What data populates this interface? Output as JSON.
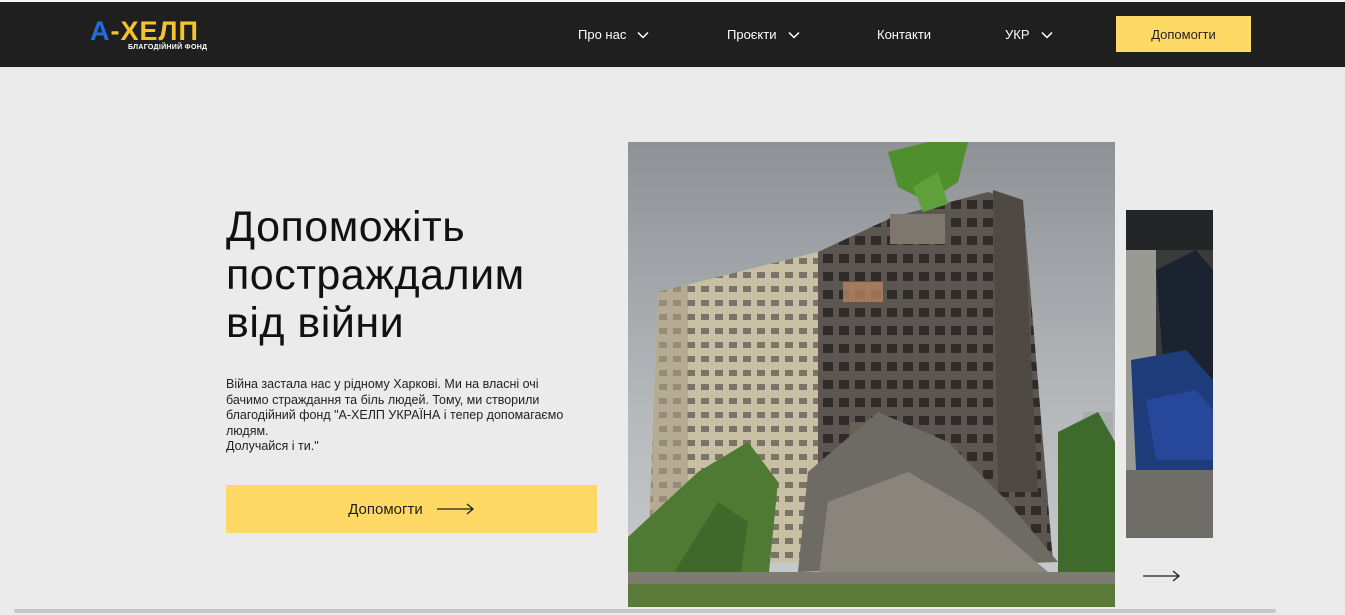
{
  "header": {
    "logo": {
      "mark": "А",
      "name": "-ХЕЛП",
      "subtitle": "БЛАГОДІЙНИЙ ФОНД"
    },
    "nav": [
      {
        "label": "Про нас",
        "has_dropdown": true
      },
      {
        "label": "Проєкти",
        "has_dropdown": true
      },
      {
        "label": "Контакти",
        "has_dropdown": false
      },
      {
        "label": "УКР",
        "has_dropdown": true
      }
    ],
    "cta_label": "Допомогти"
  },
  "hero": {
    "title_lines": [
      "Допоможіть",
      "постраждалим",
      "від війни"
    ],
    "description_lines": [
      "Війна застала нас у рідному Харкові. Ми на власні очі",
      "бачимо страждання та біль людей. Тому, ми створили",
      "благодійний фонд \"А-ХЕЛП УКРАЇНА і тепер допомагаємо",
      "людям.",
      "Долучайся і ти.\""
    ],
    "button_label": "Допомогти"
  },
  "slider": {
    "slides": [
      "damaged-building-photo",
      "volunteer-photo"
    ],
    "next_icon": "arrow-right-icon"
  },
  "colors": {
    "header_bg": "#1f1f1f",
    "accent_yellow": "#ffd966",
    "logo_blue": "#1e6fd9",
    "logo_yellow": "#f5c42c",
    "page_bg": "#ebebeb"
  }
}
